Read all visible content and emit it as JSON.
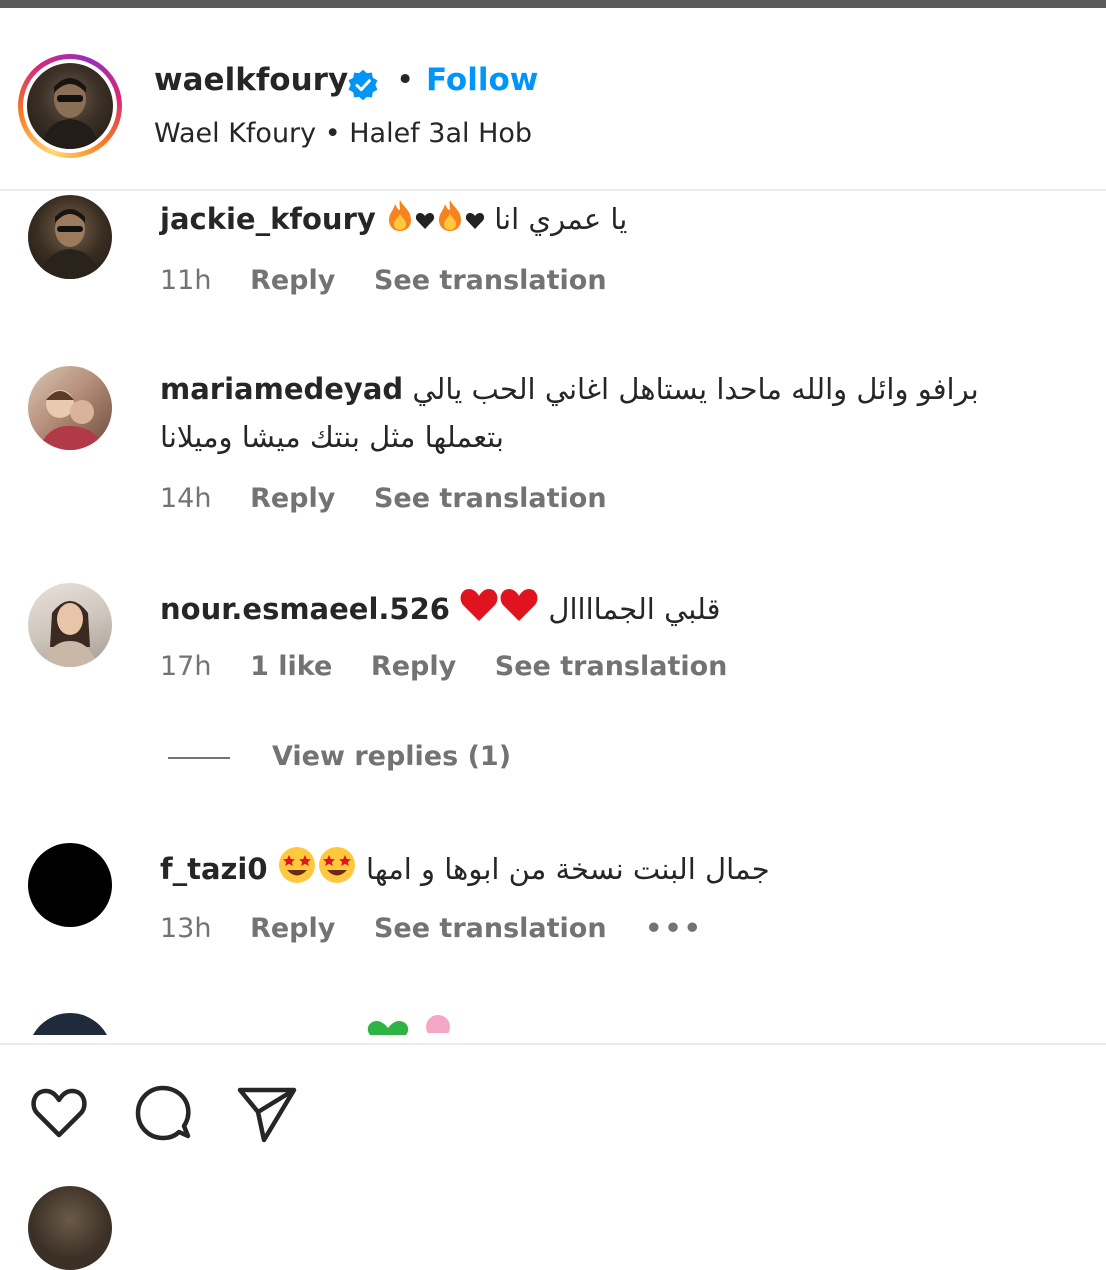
{
  "header": {
    "username": "waelkfoury",
    "separator": "•",
    "follow_label": "Follow",
    "subtitle": "Wael Kfoury • Halef 3al Hob",
    "verified_icon": "verified-badge-icon"
  },
  "comments": [
    {
      "username": "jackie_kfoury",
      "text": "يا عمري انا",
      "emoji": [
        "fire",
        "heart-black",
        "fire",
        "heart-black"
      ],
      "time": "11h",
      "reply_label": "Reply",
      "translate_label": "See translation"
    },
    {
      "username": "mariamedeyad",
      "text": "برافو وائل والله ماحدا يستاهل اغاني الحب يالي",
      "text_line2": "بتعملها مثل بنتك ميشا وميلانا",
      "time": "14h",
      "reply_label": "Reply",
      "translate_label": "See translation"
    },
    {
      "username": "nour.esmaeel.526",
      "text": "قلبي الجماااال",
      "emoji": [
        "red-heart",
        "red-heart"
      ],
      "time": "17h",
      "likes": "1 like",
      "reply_label": "Reply",
      "translate_label": "See translation",
      "view_replies": "View replies (1)"
    },
    {
      "username": "f_tazi0",
      "text": "جمال البنت نسخة من ابوها و امها",
      "emoji": [
        "star-struck",
        "star-struck"
      ],
      "time": "13h",
      "reply_label": "Reply",
      "translate_label": "See translation",
      "more_label": "•••"
    }
  ],
  "actions": {
    "like_icon": "heart-outline-icon",
    "comment_icon": "comment-bubble-icon",
    "share_icon": "paper-plane-icon"
  },
  "colors": {
    "link_blue": "#0095f6",
    "meta_gray": "#737373",
    "text": "#262626",
    "heart_red": "#e0141e",
    "verified_blue": "#0095f6"
  }
}
